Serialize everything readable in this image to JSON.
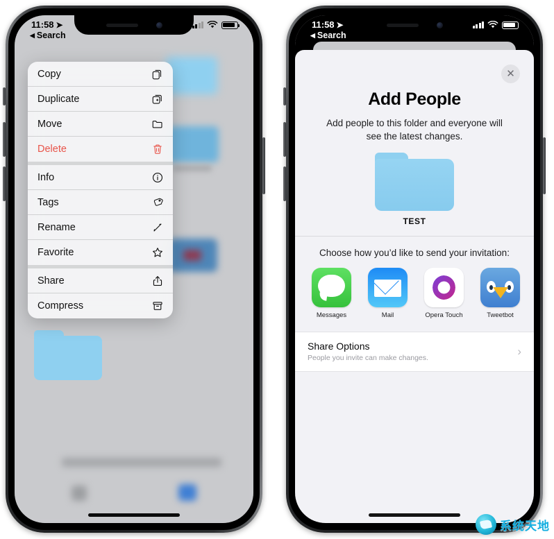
{
  "status_bar": {
    "time": "11:58",
    "location_arrow": "➤",
    "back_label": "Search",
    "back_caret": "◀"
  },
  "left_phone": {
    "context_menu": {
      "groups": [
        {
          "items": [
            {
              "label": "Copy",
              "icon": "copy-icon"
            },
            {
              "label": "Duplicate",
              "icon": "duplicate-icon"
            },
            {
              "label": "Move",
              "icon": "folder-icon"
            },
            {
              "label": "Delete",
              "icon": "trash-icon",
              "destructive": true
            }
          ]
        },
        {
          "items": [
            {
              "label": "Info",
              "icon": "info-icon"
            },
            {
              "label": "Tags",
              "icon": "tag-icon"
            },
            {
              "label": "Rename",
              "icon": "pencil-icon"
            },
            {
              "label": "Favorite",
              "icon": "star-icon"
            }
          ]
        },
        {
          "items": [
            {
              "label": "Share",
              "icon": "share-icon"
            },
            {
              "label": "Compress",
              "icon": "archive-icon"
            }
          ]
        }
      ]
    },
    "background": {
      "folder_color": "#8fd0f0"
    }
  },
  "right_phone": {
    "sheet": {
      "close_label": "✕",
      "title": "Add People",
      "subtitle": "Add people to this folder and everyone will see the latest changes.",
      "folder_name": "TEST",
      "folder_color": "#8fd0f0",
      "choose_label": "Choose how you’d like to send your invitation:",
      "apps": [
        {
          "label": "Messages",
          "icon": "messages-icon"
        },
        {
          "label": "Mail",
          "icon": "mail-icon"
        },
        {
          "label": "Opera Touch",
          "icon": "opera-touch-icon"
        },
        {
          "label": "Tweetbot",
          "icon": "tweetbot-icon"
        },
        {
          "label": "",
          "icon": "more-apps-icon"
        }
      ],
      "share_options": {
        "title": "Share Options",
        "subtitle": "People you invite can make changes.",
        "chevron": "›"
      }
    }
  },
  "watermark": {
    "text": "系统天地",
    "accent_color": "#13aee0"
  }
}
